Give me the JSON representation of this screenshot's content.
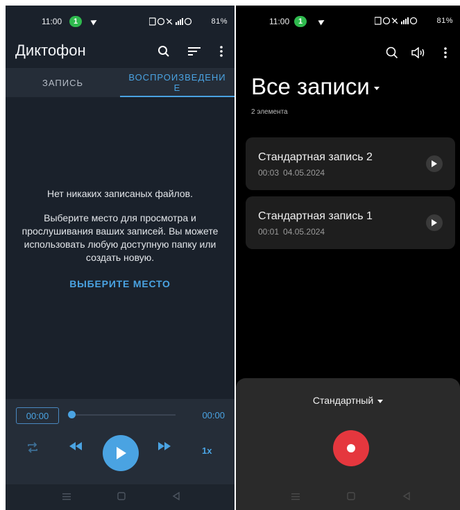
{
  "left": {
    "status": {
      "time": "11:00",
      "pill": "1",
      "right": "81%"
    },
    "app_title": "Диктофон",
    "tabs": {
      "record": "ЗАПИСЬ",
      "playback_line1": "ВОСПРОИЗВЕДЕНИ",
      "playback_line2": "Е"
    },
    "empty": {
      "title": "Нет никаких записаных файлов.",
      "message": "Выберите место для просмотра и прослушивания ваших записей. Вы можете использовать любую доступную папку или создать новую."
    },
    "choose_label": "ВЫБЕРИТЕ МЕСТО",
    "player": {
      "current_time": "00:00",
      "end_time": "00:00",
      "speed": "1x",
      "progress": 0
    },
    "colors": {
      "accent": "#4aa3e2",
      "background": "#1a212b"
    }
  },
  "right": {
    "status": {
      "time": "11:00",
      "pill": "1",
      "right": "81%"
    },
    "title": "Все записи",
    "count": "2 элемента",
    "recordings": [
      {
        "name": "Стандартная запись 2",
        "duration": "00:03",
        "date": "04.05.2024"
      },
      {
        "name": "Стандартная запись 1",
        "duration": "00:01",
        "date": "04.05.2024"
      }
    ],
    "mode": "Стандартный",
    "colors": {
      "record": "#e5373e",
      "background": "#000000"
    }
  }
}
